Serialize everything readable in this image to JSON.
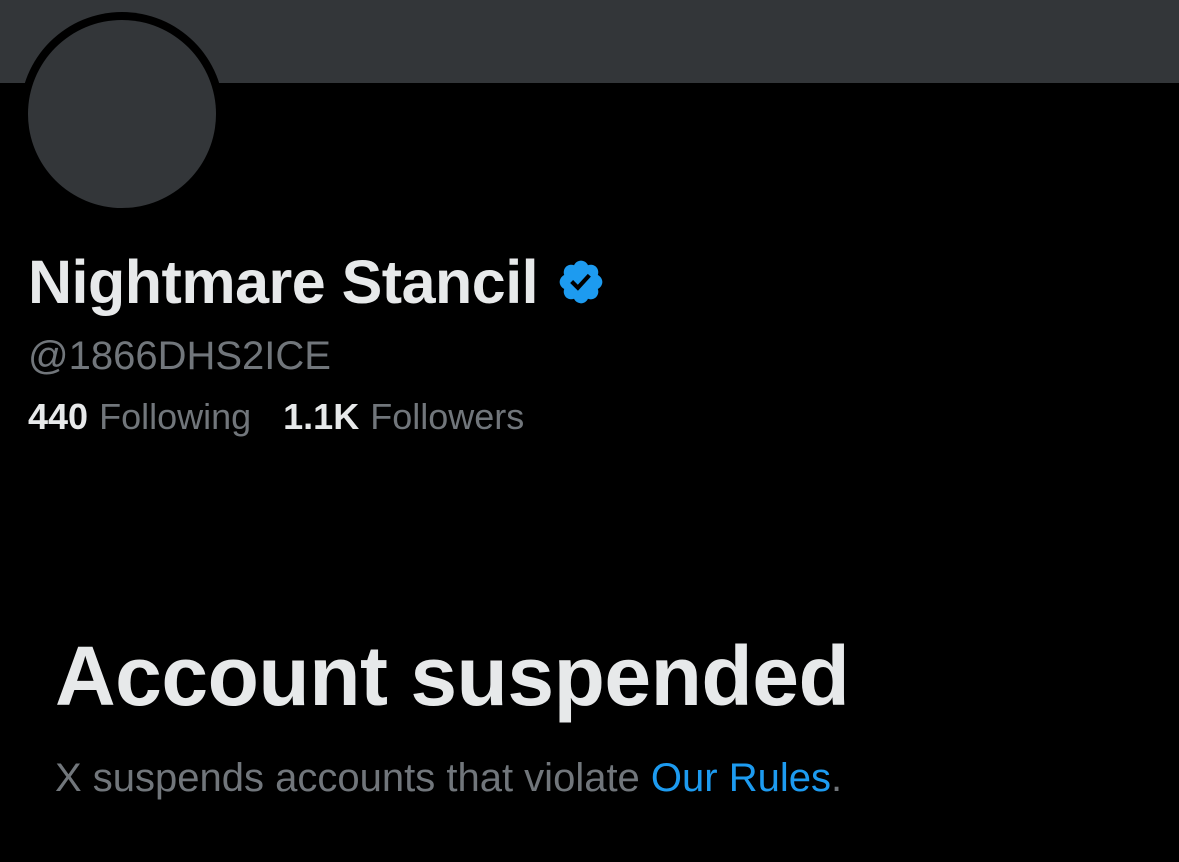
{
  "profile": {
    "display_name": "Nightmare Stancil",
    "handle": "@1866DHS2ICE",
    "verified_icon": "verified-badge-icon",
    "following_count": "440",
    "following_label": "Following",
    "followers_count": "1.1K",
    "followers_label": "Followers"
  },
  "suspension": {
    "title": "Account suspended",
    "message_prefix": "X suspends accounts that violate ",
    "rules_link_text": "Our Rules",
    "message_suffix": "."
  },
  "colors": {
    "background": "#000000",
    "banner": "#333639",
    "primary_text": "#e7e9ea",
    "secondary_text": "#71767b",
    "accent": "#1d9bf0"
  }
}
